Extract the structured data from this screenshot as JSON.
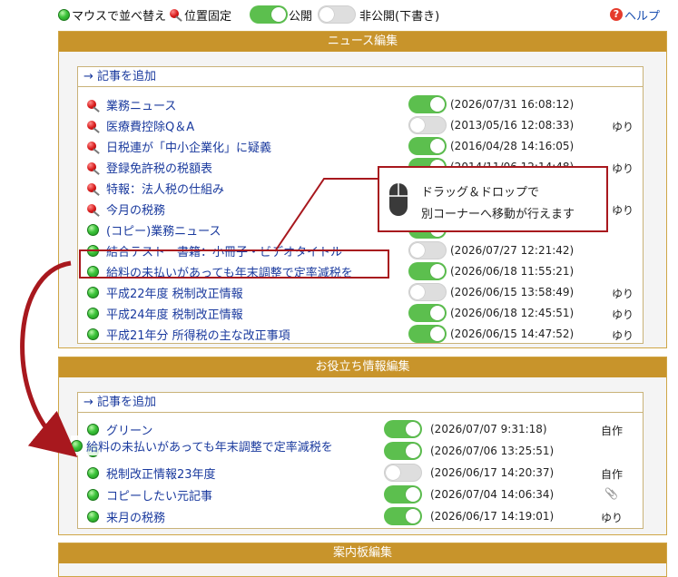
{
  "legend": {
    "sort_label": "マウスで並べ替え",
    "fixed_label": "位置固定",
    "public_label": "公開",
    "private_label": "非公開(下書き)"
  },
  "help_label": "ヘルプ",
  "colors": {
    "accent": "#c8942b",
    "toggle_on": "#5cbf4e",
    "callout_border": "#a8181e",
    "link": "#1a3a9e"
  },
  "news": {
    "header": "ニュース編集",
    "add_label": "→ 記事を追加",
    "items": [
      {
        "icon": "pin-icon",
        "title": "業務ニュース",
        "status": "on",
        "date": "(2026/07/31 16:08:12)",
        "author": ""
      },
      {
        "icon": "pin-icon",
        "title": "医療費控除Q＆A",
        "status": "off",
        "date": "(2013/05/16 12:08:33)",
        "author": "ゆり"
      },
      {
        "icon": "pin-icon",
        "title": "日税連が「中小企業化」に疑義",
        "status": "on",
        "date": "(2016/04/28 14:16:05)",
        "author": ""
      },
      {
        "icon": "pin-icon",
        "title": "登録免許税の税額表",
        "status": "on",
        "date": "(2014/11/06 12:14:48)",
        "author": "ゆり"
      },
      {
        "icon": "pin-icon",
        "title": "特報：法人税の仕組み",
        "status": "on",
        "date": "",
        "author": ""
      },
      {
        "icon": "pin-icon",
        "title": "今月の税務",
        "status": "on",
        "date": "",
        "author": "ゆり"
      },
      {
        "icon": "drag-dot-icon",
        "title": "(コピー)業務ニュース",
        "status": "on",
        "date": "",
        "author": ""
      },
      {
        "icon": "drag-dot-icon",
        "title": "結合テスト　書籍：小冊子・ビデオタイトル",
        "status": "off",
        "date": "(2026/07/27 12:21:42)",
        "author": ""
      },
      {
        "icon": "drag-dot-icon",
        "title": "給料の未払いがあっても年末調整で定率減税を",
        "status": "on",
        "date": "(2026/06/18 11:55:21)",
        "author": ""
      },
      {
        "icon": "drag-dot-icon",
        "title": "平成22年度 税制改正情報",
        "status": "off",
        "date": "(2026/06/15 13:58:49)",
        "author": "ゆり"
      },
      {
        "icon": "drag-dot-icon",
        "title": "平成24年度 税制改正情報",
        "status": "on",
        "date": "(2026/06/18 12:45:51)",
        "author": "ゆり"
      },
      {
        "icon": "drag-dot-icon",
        "title": "平成21年分 所得税の主な改正事項",
        "status": "on",
        "date": "(2026/06/15 14:47:52)",
        "author": "ゆり"
      }
    ]
  },
  "useful": {
    "header": "お役立ち情報編集",
    "add_label": "→ 記事を追加",
    "items": [
      {
        "icon": "drag-dot-icon",
        "title": "グリーン",
        "status": "on",
        "date": "(2026/07/07 9:31:18)",
        "author": "自作"
      },
      {
        "icon": "drag-dot-icon",
        "title": "",
        "status": "on",
        "date": "(2026/07/06 13:25:51)",
        "author": ""
      },
      {
        "icon": "drag-dot-icon",
        "title": "税制改正情報23年度",
        "status": "off",
        "date": "(2026/06/17 14:20:37)",
        "author": "自作"
      },
      {
        "icon": "drag-dot-icon",
        "title": "コピーしたい元記事",
        "status": "on",
        "date": "(2026/07/04 14:06:34)",
        "author": "paperclip-icon"
      },
      {
        "icon": "drag-dot-icon",
        "title": "来月の税務",
        "status": "on",
        "date": "(2026/06/17 14:19:01)",
        "author": "ゆり"
      }
    ]
  },
  "dragged_item": {
    "title": "給料の未払いがあっても年末調整で定率減税を"
  },
  "callout": {
    "line1": "ドラッグ＆ドロップで",
    "line2": "別コーナーへ移動が行えます",
    "icon": "mouse-icon"
  },
  "board": {
    "header": "案内板編集"
  }
}
